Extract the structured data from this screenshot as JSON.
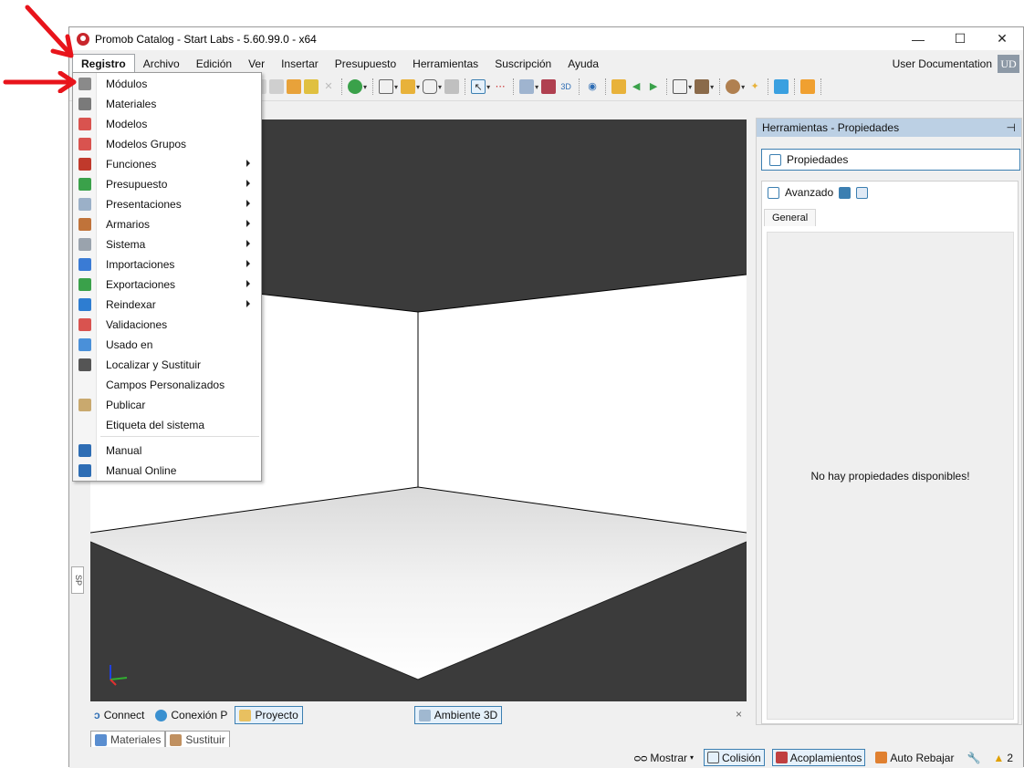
{
  "window": {
    "title": "Promob Catalog - Start Labs - 5.60.99.0 - x64",
    "minimize": "—",
    "maximize": "☐",
    "close": "✕"
  },
  "menu": {
    "items": [
      "Registro",
      "Archivo",
      "Edición",
      "Ver",
      "Insertar",
      "Presupuesto",
      "Herramientas",
      "Suscripción",
      "Ayuda"
    ],
    "active": "Registro"
  },
  "user": {
    "label": "User Documentation",
    "initials": "UD"
  },
  "dropdown": {
    "items": [
      {
        "label": "Módulos",
        "icon": "modules-icon",
        "submenu": false,
        "color": "#8a8a8a"
      },
      {
        "label": "Materiales",
        "icon": "materials-icon",
        "submenu": false,
        "color": "#7a7a7a"
      },
      {
        "label": "Modelos",
        "icon": "models-icon",
        "submenu": false,
        "color": "#d9534f"
      },
      {
        "label": "Modelos Grupos",
        "icon": "model-groups-icon",
        "submenu": false,
        "color": "#d9534f"
      },
      {
        "label": "Funciones",
        "icon": "functions-icon",
        "submenu": true,
        "color": "#c0392b"
      },
      {
        "label": "Presupuesto",
        "icon": "budget-icon",
        "submenu": true,
        "color": "#3aa14a"
      },
      {
        "label": "Presentaciones",
        "icon": "presentations-icon",
        "submenu": true,
        "color": "#9bb0c8"
      },
      {
        "label": "Armarios",
        "icon": "cabinets-icon",
        "submenu": true,
        "color": "#c0733a"
      },
      {
        "label": "Sistema",
        "icon": "system-gear-icon",
        "submenu": true,
        "color": "#9aa3ad"
      },
      {
        "label": "Importaciones",
        "icon": "import-icon",
        "submenu": true,
        "color": "#3a7bd5"
      },
      {
        "label": "Exportaciones",
        "icon": "export-icon",
        "submenu": true,
        "color": "#3aa14a"
      },
      {
        "label": "Reindexar",
        "icon": "reindex-icon",
        "submenu": true,
        "color": "#2e7dd1"
      },
      {
        "label": "Validaciones",
        "icon": "validations-icon",
        "submenu": false,
        "color": "#d9534f"
      },
      {
        "label": "Usado en",
        "icon": "used-in-icon",
        "submenu": false,
        "color": "#4a90d9"
      },
      {
        "label": "Localizar y Sustituir",
        "icon": "search-replace-icon",
        "submenu": false,
        "color": "#555555"
      },
      {
        "label": "Campos Personalizados",
        "icon": "",
        "submenu": false,
        "color": ""
      },
      {
        "label": "Publicar",
        "icon": "publish-icon",
        "submenu": false,
        "color": "#c9a96e"
      },
      {
        "label": "Etiqueta del sistema",
        "icon": "",
        "submenu": false,
        "color": ""
      },
      {
        "label": "Manual",
        "icon": "manual-book-icon",
        "submenu": false,
        "color": "#2e6db4"
      },
      {
        "label": "Manual Online",
        "icon": "help-online-icon",
        "submenu": false,
        "color": "#2e6db4"
      }
    ]
  },
  "bottom_tabs": {
    "connect": "Connect",
    "conexion": "Conexión P",
    "proyecto": "Proyecto",
    "ambiente": "Ambiente 3D",
    "close": "×"
  },
  "dock_tabs": {
    "materiales": "Materiales",
    "sustituir": "Sustituir"
  },
  "side_tab": "SP",
  "status": {
    "mostrar": "Mostrar",
    "colision": "Colisión",
    "acoplamientos": "Acoplamientos",
    "auto_rebajar": "Auto Rebajar",
    "warnings": "2"
  },
  "panel": {
    "header": "Herramientas - Propiedades",
    "pin": "⊣",
    "propiedades": "Propiedades",
    "avanzado": "Avanzado",
    "general_tab": "General",
    "empty_message": "No hay propiedades disponibles!"
  },
  "colors": {
    "accent": "#3c7fb1",
    "panel_header": "#bcd0e4",
    "annotation_arrow": "#e8141b",
    "viewport_dark": "#3b3b3b"
  }
}
